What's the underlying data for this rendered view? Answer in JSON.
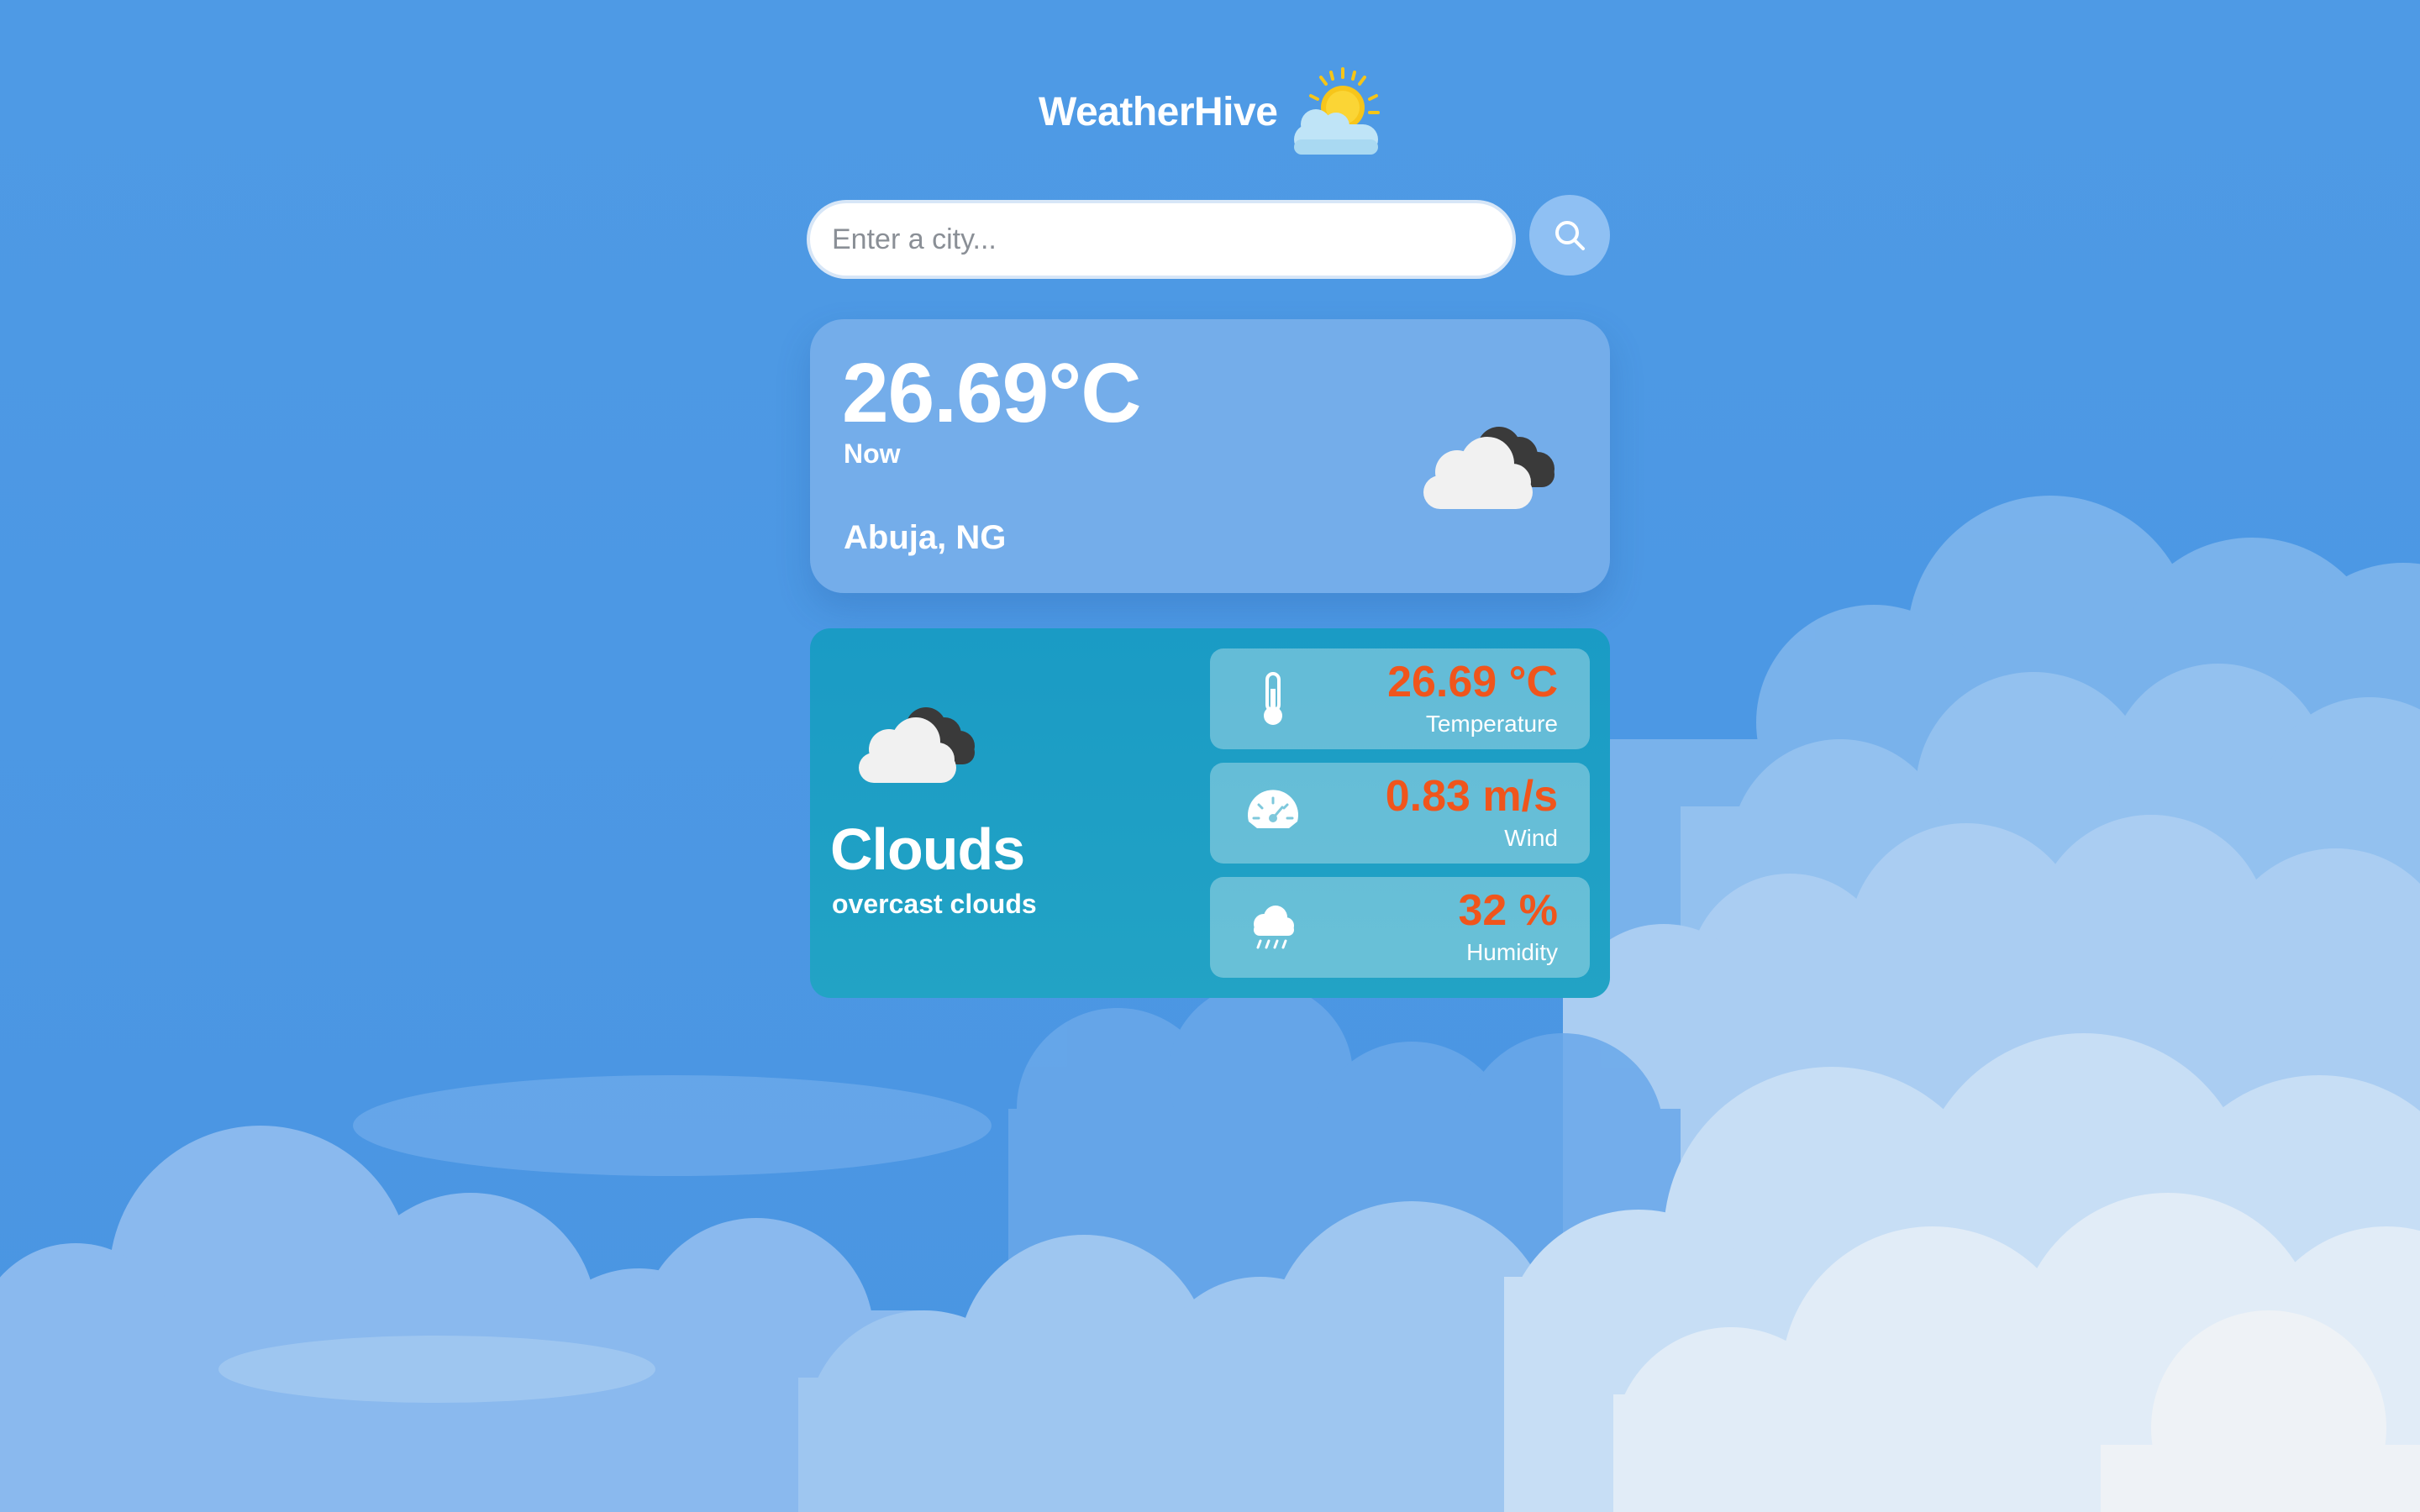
{
  "app": {
    "name": "WeatherHive",
    "logo_icon": "sun-behind-cloud-icon"
  },
  "search": {
    "placeholder": "Enter a city...",
    "value": "",
    "button_icon": "search-icon"
  },
  "current": {
    "temperature": "26.69°C",
    "time_label": "Now",
    "location": "Abuja, NG",
    "icon": "overcast-clouds-icon"
  },
  "details": {
    "icon": "overcast-clouds-icon",
    "condition": "Clouds",
    "description": "overcast clouds",
    "metrics": [
      {
        "value": "26.69 °C",
        "label": "Temperature",
        "icon": "thermometer-icon"
      },
      {
        "value": "0.83 m/s",
        "label": "Wind",
        "icon": "speedometer-icon"
      },
      {
        "value": "32 %",
        "label": "Humidity",
        "icon": "rain-cloud-icon"
      }
    ]
  },
  "colors": {
    "sky": "#4e9ae5",
    "current_card": "#74adea",
    "details_card": "#1a9bc5",
    "metric_value": "#f0551c",
    "search_button": "#8fc0f3"
  }
}
